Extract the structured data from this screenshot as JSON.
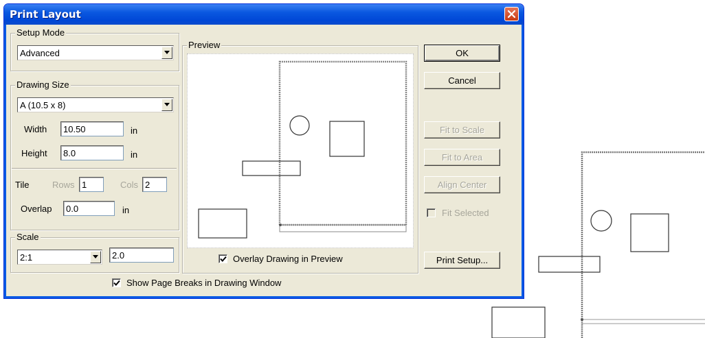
{
  "window": {
    "title": "Print Layout"
  },
  "setup_mode": {
    "label": "Setup Mode",
    "value": "Advanced"
  },
  "drawing_size": {
    "label": "Drawing Size",
    "value": "A (10.5 x 8)",
    "width_label": "Width",
    "width_value": "10.50",
    "width_unit": "in",
    "height_label": "Height",
    "height_value": "8.0",
    "height_unit": "in"
  },
  "tile": {
    "label": "Tile",
    "rows_label": "Rows",
    "rows_value": "1",
    "cols_label": "Cols",
    "cols_value": "2",
    "overlap_label": "Overlap",
    "overlap_value": "0.0",
    "overlap_unit": "in"
  },
  "scale": {
    "label": "Scale",
    "select_value": "2:1",
    "value": "2.0"
  },
  "preview": {
    "label": "Preview",
    "overlay_label": "Overlay Drawing in Preview",
    "overlay_checked": true
  },
  "page_breaks": {
    "label": "Show Page Breaks in Drawing Window",
    "checked": true
  },
  "buttons": {
    "ok": "OK",
    "cancel": "Cancel",
    "fit_to_scale": "Fit to Scale",
    "fit_to_area": "Fit to Area",
    "align_center": "Align Center",
    "fit_selected": "Fit Selected",
    "print_setup": "Print Setup..."
  },
  "icons": {
    "close": "close-icon",
    "dropdown": "chevron-down-icon",
    "check": "checkmark-icon"
  },
  "colors": {
    "titlebar": "#0a58e0",
    "dialog_bg": "#ece9d8",
    "close_button": "#d9532b"
  }
}
